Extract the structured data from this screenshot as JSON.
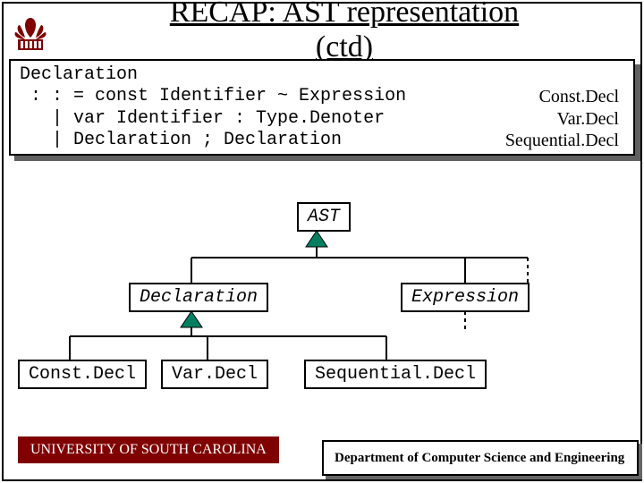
{
  "title_top": "RECAP: AST representation",
  "title_bot": "(ctd)",
  "grammar": {
    "head": "Declaration",
    "r1": " : : = const Identifier ~ Expression",
    "r1t": "Const.Decl",
    "r2": "   | var Identifier : Type.Denoter",
    "r2t": "Var.Decl",
    "r3": "   | Declaration ; Declaration",
    "r3t": "Sequential.Decl"
  },
  "nodes": {
    "ast": "AST",
    "decl": "Declaration",
    "expr": "Expression",
    "constd": "Const.Decl",
    "vard": "Var.Decl",
    "seqd": "Sequential.Decl"
  },
  "footer_left": "UNIVERSITY OF SOUTH CAROLINA",
  "footer_right": "Department of Computer Science and Engineering"
}
